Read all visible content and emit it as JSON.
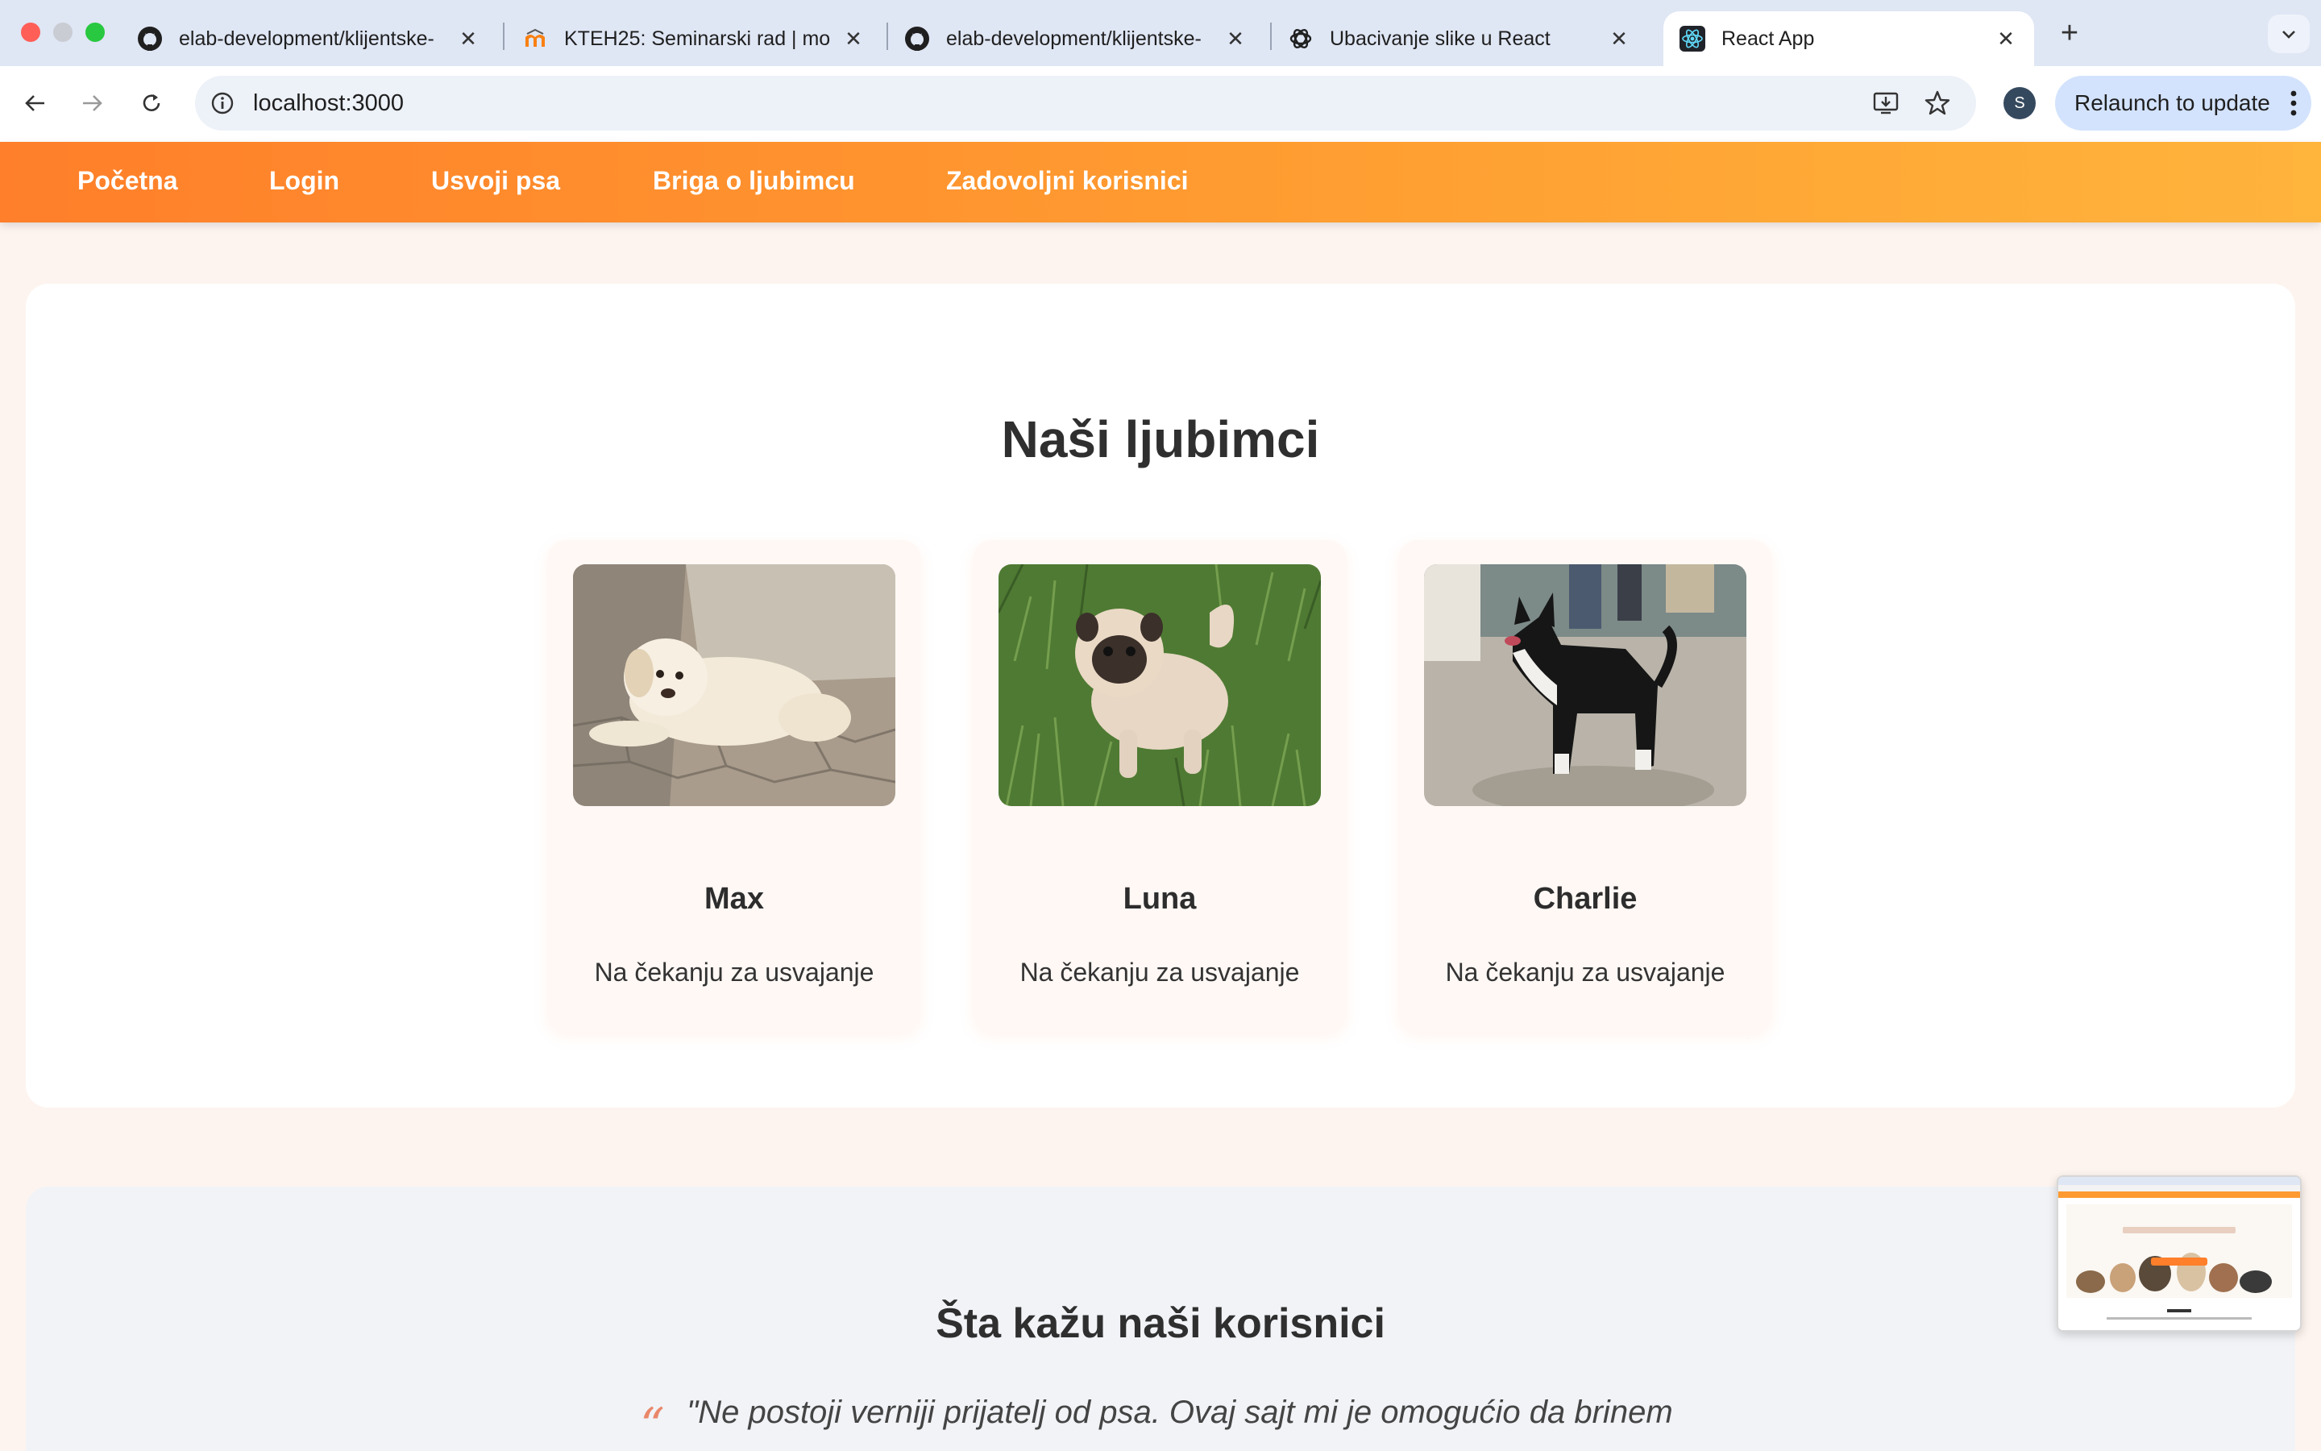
{
  "browser": {
    "tabs": [
      {
        "title": "elab-development/klijentske-",
        "icon": "github-icon"
      },
      {
        "title": "KTEH25: Seminarski rad | mo",
        "icon": "moodle-icon"
      },
      {
        "title": "elab-development/klijentske-",
        "icon": "github-icon"
      },
      {
        "title": "Ubacivanje slike u React",
        "icon": "chatgpt-icon"
      },
      {
        "title": "React App",
        "icon": "react-icon",
        "active": true
      }
    ],
    "url": "localhost:3000",
    "profile_initial": "S",
    "relaunch_label": "Relaunch to update"
  },
  "nav": {
    "items": [
      "Početna",
      "Login",
      "Usvoji psa",
      "Briga o ljubimcu",
      "Zadovoljni korisnici"
    ],
    "gradient": [
      "#ff7f2a",
      "#ffb43c"
    ]
  },
  "pets": {
    "title": "Naši ljubimci",
    "cards": [
      {
        "name": "Max",
        "status": "Na čekanju za usvajanje"
      },
      {
        "name": "Luna",
        "status": "Na čekanju za usvajanje"
      },
      {
        "name": "Charlie",
        "status": "Na čekanju za usvajanje"
      }
    ]
  },
  "testimonials": {
    "title": "Šta kažu naši korisnici",
    "quote_mark": "“",
    "quote": "\"Ne postoji verniji prijatelj od psa. Ovaj sajt mi je omogućio da brinem"
  },
  "colors": {
    "accent": "#ff8c2e",
    "quote_mark": "#e9876a",
    "card_bg": "#fff8f5"
  }
}
